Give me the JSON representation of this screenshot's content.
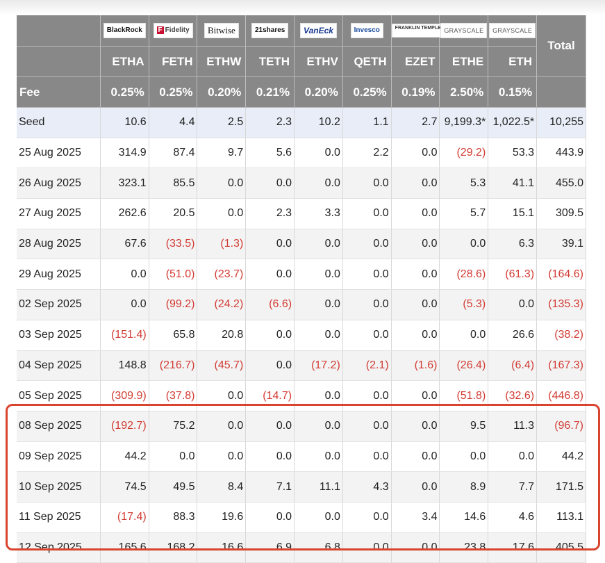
{
  "issuers": [
    {
      "logo": "BlackRock",
      "ticker": "ETHA",
      "fee": "0.25%"
    },
    {
      "logo": "Fidelity",
      "ticker": "FETH",
      "fee": "0.25%"
    },
    {
      "logo": "Bitwise",
      "ticker": "ETHW",
      "fee": "0.20%"
    },
    {
      "logo": "21shares",
      "ticker": "TETH",
      "fee": "0.21%"
    },
    {
      "logo": "VanEck",
      "ticker": "ETHV",
      "fee": "0.20%"
    },
    {
      "logo": "Invesco",
      "ticker": "QETH",
      "fee": "0.25%"
    },
    {
      "logo": "FRANKLIN TEMPLETON",
      "ticker": "EZET",
      "fee": "0.19%"
    },
    {
      "logo": "GRAYSCALE",
      "ticker": "ETHE",
      "fee": "2.50%"
    },
    {
      "logo": "GRAYSCALE",
      "ticker": "ETH",
      "fee": "0.15%"
    }
  ],
  "total_label": "Total",
  "fee_label": "Fee",
  "rows": [
    {
      "label": "Seed",
      "values": [
        "10.6",
        "4.4",
        "2.5",
        "2.3",
        "10.2",
        "1.1",
        "2.7",
        "9,199.3*",
        "1,022.5*",
        "10,255"
      ]
    },
    {
      "label": "25 Aug 2025",
      "values": [
        "314.9",
        "87.4",
        "9.7",
        "5.6",
        "0.0",
        "2.2",
        "0.0",
        "(29.2)",
        "53.3",
        "443.9"
      ]
    },
    {
      "label": "26 Aug 2025",
      "values": [
        "323.1",
        "85.5",
        "0.0",
        "0.0",
        "0.0",
        "0.0",
        "0.0",
        "5.3",
        "41.1",
        "455.0"
      ]
    },
    {
      "label": "27 Aug 2025",
      "values": [
        "262.6",
        "20.5",
        "0.0",
        "2.3",
        "3.3",
        "0.0",
        "0.0",
        "5.7",
        "15.1",
        "309.5"
      ]
    },
    {
      "label": "28 Aug 2025",
      "values": [
        "67.6",
        "(33.5)",
        "(1.3)",
        "0.0",
        "0.0",
        "0.0",
        "0.0",
        "0.0",
        "6.3",
        "39.1"
      ]
    },
    {
      "label": "29 Aug 2025",
      "values": [
        "0.0",
        "(51.0)",
        "(23.7)",
        "0.0",
        "0.0",
        "0.0",
        "0.0",
        "(28.6)",
        "(61.3)",
        "(164.6)"
      ]
    },
    {
      "label": "02 Sep 2025",
      "values": [
        "0.0",
        "(99.2)",
        "(24.2)",
        "(6.6)",
        "0.0",
        "0.0",
        "0.0",
        "(5.3)",
        "0.0",
        "(135.3)"
      ]
    },
    {
      "label": "03 Sep 2025",
      "values": [
        "(151.4)",
        "65.8",
        "20.8",
        "0.0",
        "0.0",
        "0.0",
        "0.0",
        "0.0",
        "26.6",
        "(38.2)"
      ]
    },
    {
      "label": "04 Sep 2025",
      "values": [
        "148.8",
        "(216.7)",
        "(45.7)",
        "0.0",
        "(17.2)",
        "(2.1)",
        "(1.6)",
        "(26.4)",
        "(6.4)",
        "(167.3)"
      ]
    },
    {
      "label": "05 Sep 2025",
      "values": [
        "(309.9)",
        "(37.8)",
        "0.0",
        "(14.7)",
        "0.0",
        "0.0",
        "0.0",
        "(51.8)",
        "(32.6)",
        "(446.8)"
      ]
    },
    {
      "label": "08 Sep 2025",
      "values": [
        "(192.7)",
        "75.2",
        "0.0",
        "0.0",
        "0.0",
        "0.0",
        "0.0",
        "9.5",
        "11.3",
        "(96.7)"
      ]
    },
    {
      "label": "09 Sep 2025",
      "values": [
        "44.2",
        "0.0",
        "0.0",
        "0.0",
        "0.0",
        "0.0",
        "0.0",
        "0.0",
        "0.0",
        "44.2"
      ]
    },
    {
      "label": "10 Sep 2025",
      "values": [
        "74.5",
        "49.5",
        "8.4",
        "7.1",
        "11.1",
        "4.3",
        "0.0",
        "8.9",
        "7.7",
        "171.5"
      ]
    },
    {
      "label": "11 Sep 2025",
      "values": [
        "(17.4)",
        "88.3",
        "19.6",
        "0.0",
        "0.0",
        "0.0",
        "3.4",
        "14.6",
        "4.6",
        "113.1"
      ]
    },
    {
      "label": "12 Sep 2025",
      "values": [
        "165.6",
        "168.2",
        "16.6",
        "6.9",
        "6.8",
        "0.0",
        "0.0",
        "23.8",
        "17.6",
        "405.5"
      ]
    }
  ],
  "colors": {
    "header_bg": "#888888",
    "negative": "#d23b33",
    "seed_row_bg": "#e8edf7",
    "highlight_border": "#d9442e"
  }
}
